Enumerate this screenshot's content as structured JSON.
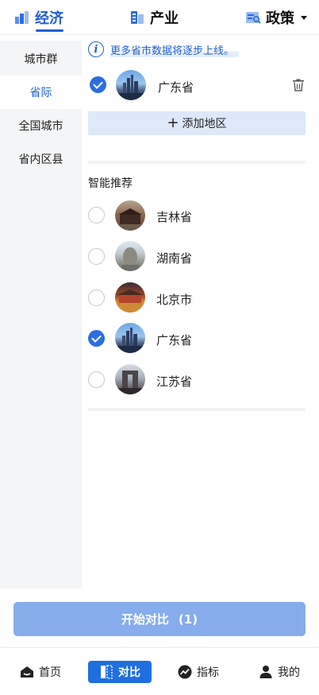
{
  "top_tabs": [
    {
      "label": "经济",
      "icon": "economy-icon",
      "active": true
    },
    {
      "label": "产业",
      "icon": "industry-icon",
      "active": false
    },
    {
      "label": "政策",
      "icon": "policy-icon",
      "active": false,
      "has_dropdown": true
    }
  ],
  "sidebar": {
    "items": [
      {
        "label": "城市群",
        "active": false
      },
      {
        "label": "省际",
        "active": true
      },
      {
        "label": "全国城市",
        "active": false
      },
      {
        "label": "省内区县",
        "active": false
      }
    ]
  },
  "notice": {
    "text": "更多省市数据将逐步上线。",
    "icon": "info-icon"
  },
  "selected": [
    {
      "label": "广东省",
      "checked": true,
      "image": "guangdong-skyline"
    }
  ],
  "add_region_label": "添加地区",
  "recommend": {
    "title": "智能推荐",
    "items": [
      {
        "label": "吉林省",
        "checked": false,
        "image": "jilin-landmark"
      },
      {
        "label": "湖南省",
        "checked": false,
        "image": "hunan-statue"
      },
      {
        "label": "北京市",
        "checked": false,
        "image": "beijing-palace"
      },
      {
        "label": "广东省",
        "checked": true,
        "image": "guangdong-skyline"
      },
      {
        "label": "江苏省",
        "checked": false,
        "image": "jiangsu-gate"
      }
    ]
  },
  "start_button": {
    "label": "开始对比",
    "count": "(1)"
  },
  "bottom_nav": [
    {
      "label": "首页",
      "icon": "home-icon",
      "active": false
    },
    {
      "label": "对比",
      "icon": "compare-icon",
      "active": true
    },
    {
      "label": "指标",
      "icon": "trend-icon",
      "active": false
    },
    {
      "label": "我的",
      "icon": "user-icon",
      "active": false
    }
  ],
  "colors": {
    "accent": "#1f5fd1",
    "button_disabled": "#86acec",
    "sidebar_bg": "#f4f5f7"
  }
}
